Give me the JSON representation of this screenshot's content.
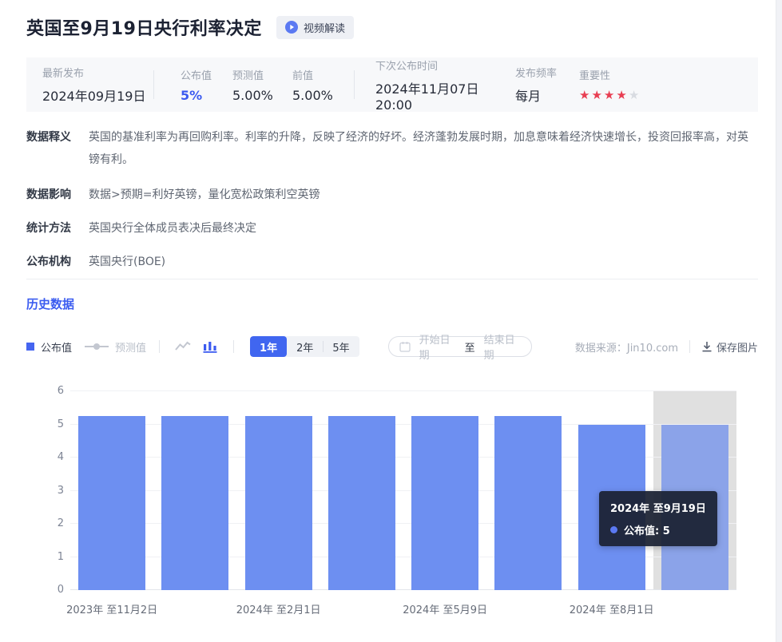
{
  "page": {
    "title": "英国至9月19日央行利率决定",
    "video_badge": "视频解读"
  },
  "stats": {
    "latest_label": "最新发布",
    "latest_value": "2024年09月19日",
    "published_label": "公布值",
    "published_value": "5%",
    "forecast_label": "预测值",
    "forecast_value": "5.00%",
    "previous_label": "前值",
    "previous_value": "5.00%",
    "next_label": "下次公布时间",
    "next_value": "2024年11月07日 20:00",
    "frequency_label": "发布频率",
    "frequency_value": "每月",
    "importance_label": "重要性",
    "importance_stars": 4,
    "importance_total": 5,
    "star_on_color": "#e83e52",
    "star_off_color": "#d8dbe1"
  },
  "info_rows": [
    {
      "label": "数据释义",
      "content": "英国的基准利率为再回购利率。利率的升降，反映了经济的好坏。经济蓬勃发展时期，加息意味着经济快速增长，投资回报率高，对英镑有利。"
    },
    {
      "label": "数据影响",
      "content": "数据>预期=利好英镑，量化宽松政策利空英镑"
    },
    {
      "label": "统计方法",
      "content": "英国央行全体成员表决后最终决定"
    },
    {
      "label": "公布机构",
      "content": "英国央行(BOE)"
    }
  ],
  "history": {
    "heading": "历史数据",
    "legend_published": "公布值",
    "legend_forecast": "预测值",
    "range_tabs": [
      "1年",
      "2年",
      "5年"
    ],
    "active_tab": "1年",
    "date_start_placeholder": "开始日期",
    "date_to": "至",
    "date_end_placeholder": "结束日期",
    "source": "数据来源：Jin10.com",
    "save_image": "保存图片"
  },
  "tooltip": {
    "title": "2024年 至9月19日",
    "text": "公布值: 5"
  },
  "chart_data": {
    "type": "bar",
    "series_name": "公布值",
    "categories": [
      "2023年 至11月2日",
      "",
      "2024年 至2月1日",
      "",
      "2024年 至5月9日",
      "",
      "2024年 至8月1日",
      "2024年 至9月19日"
    ],
    "values": [
      5.25,
      5.25,
      5.25,
      5.25,
      5.25,
      5.25,
      5,
      5
    ],
    "x_axis_labels_shown": [
      "2023年 至11月2日",
      "2024年 至2月1日",
      "2024年 至5月9日",
      "2024年 至8月1日"
    ],
    "ylim": [
      0,
      6
    ],
    "y_ticks": [
      0,
      1,
      2,
      3,
      4,
      5,
      6
    ],
    "grid": "horizontal",
    "legend_position": "top-left",
    "highlight_index": 7,
    "bar_color": "#6d8ff1",
    "bar_highlight_color": "#8ba3e9",
    "highlight_band_color": "#e0e0e0",
    "accent_color": "#3c5bf0"
  }
}
